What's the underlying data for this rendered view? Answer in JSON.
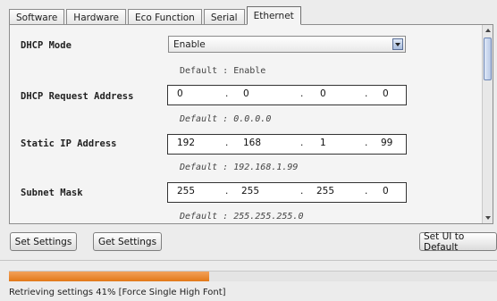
{
  "tabs": [
    {
      "label": "Software",
      "active": false
    },
    {
      "label": "Hardware",
      "active": false
    },
    {
      "label": "Eco Function",
      "active": false
    },
    {
      "label": "Serial",
      "active": false
    },
    {
      "label": "Ethernet",
      "active": true
    }
  ],
  "fields": {
    "dhcp_mode": {
      "label": "DHCP Mode",
      "value": "Enable",
      "default": "Default : Enable"
    },
    "dhcp_request_address": {
      "label": "DHCP Request Address",
      "octets": [
        "0",
        "0",
        "0",
        "0"
      ],
      "separator": ".",
      "default": "Default : 0.0.0.0"
    },
    "static_ip_address": {
      "label": "Static IP Address",
      "octets": [
        "192",
        "168",
        "1",
        "99"
      ],
      "separator": ".",
      "default": "Default : 192.168.1.99"
    },
    "subnet_mask": {
      "label": "Subnet Mask",
      "octets": [
        "255",
        "255",
        "255",
        "0"
      ],
      "separator": ".",
      "default": "Default : 255.255.255.0"
    }
  },
  "buttons": {
    "set_settings": "Set Settings",
    "get_settings": "Get Settings",
    "set_ui_to_default": "Set UI to Default"
  },
  "progress": {
    "fraction": 0.41,
    "color": "#e97f1f"
  },
  "status_text": "Retrieving settings 41% [Force Single High Font]",
  "icons": {
    "dropdown": "chevron-down-icon",
    "scroll_up": "triangle-up-icon",
    "scroll_down": "triangle-down-icon"
  }
}
